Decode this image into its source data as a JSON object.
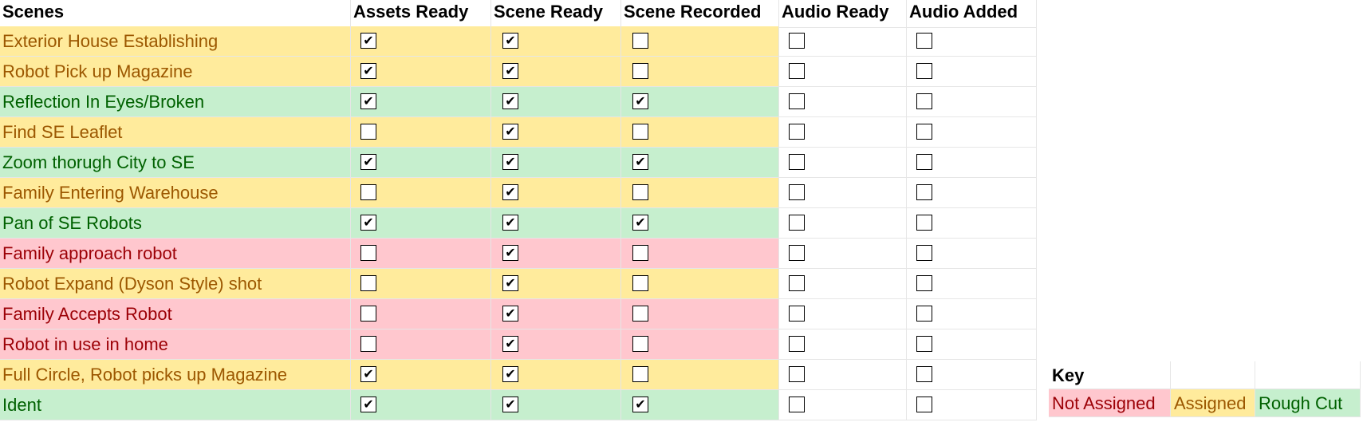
{
  "columns": {
    "scenes": "Scenes",
    "assets_ready": "Assets Ready",
    "scene_ready": "Scene Ready",
    "scene_recorded": "Scene Recorded",
    "audio_ready": "Audio Ready",
    "audio_added": "Audio Added"
  },
  "status_colors": {
    "not_assigned": {
      "bg": "#FFC7CE",
      "fg": "#9C0006"
    },
    "assigned": {
      "bg": "#FFEB9C",
      "fg": "#9C5700"
    },
    "rough_cut": {
      "bg": "#C6EFCE",
      "fg": "#006100"
    }
  },
  "rows": [
    {
      "scene": "Exterior House Establishing",
      "status": "assigned",
      "assets_ready": true,
      "scene_ready": true,
      "scene_recorded": false,
      "audio_ready": false,
      "audio_added": false
    },
    {
      "scene": "Robot Pick up Magazine",
      "status": "assigned",
      "assets_ready": true,
      "scene_ready": true,
      "scene_recorded": false,
      "audio_ready": false,
      "audio_added": false
    },
    {
      "scene": "Reflection In Eyes/Broken",
      "status": "rough_cut",
      "assets_ready": true,
      "scene_ready": true,
      "scene_recorded": true,
      "audio_ready": false,
      "audio_added": false
    },
    {
      "scene": "Find SE Leaflet",
      "status": "assigned",
      "assets_ready": false,
      "scene_ready": true,
      "scene_recorded": false,
      "audio_ready": false,
      "audio_added": false
    },
    {
      "scene": "Zoom thorugh City to SE",
      "status": "rough_cut",
      "assets_ready": true,
      "scene_ready": true,
      "scene_recorded": true,
      "audio_ready": false,
      "audio_added": false
    },
    {
      "scene": "Family Entering Warehouse",
      "status": "assigned",
      "assets_ready": false,
      "scene_ready": true,
      "scene_recorded": false,
      "audio_ready": false,
      "audio_added": false
    },
    {
      "scene": "Pan of SE Robots",
      "status": "rough_cut",
      "assets_ready": true,
      "scene_ready": true,
      "scene_recorded": true,
      "audio_ready": false,
      "audio_added": false
    },
    {
      "scene": "Family approach robot",
      "status": "not_assigned",
      "assets_ready": false,
      "scene_ready": true,
      "scene_recorded": false,
      "audio_ready": false,
      "audio_added": false
    },
    {
      "scene": "Robot Expand (Dyson Style) shot",
      "status": "assigned",
      "assets_ready": false,
      "scene_ready": true,
      "scene_recorded": false,
      "audio_ready": false,
      "audio_added": false
    },
    {
      "scene": "Family Accepts Robot",
      "status": "not_assigned",
      "assets_ready": false,
      "scene_ready": true,
      "scene_recorded": false,
      "audio_ready": false,
      "audio_added": false
    },
    {
      "scene": "Robot in use in home",
      "status": "not_assigned",
      "assets_ready": false,
      "scene_ready": true,
      "scene_recorded": false,
      "audio_ready": false,
      "audio_added": false
    },
    {
      "scene": "Full Circle, Robot picks up Magazine",
      "status": "assigned",
      "assets_ready": true,
      "scene_ready": true,
      "scene_recorded": false,
      "audio_ready": false,
      "audio_added": false
    },
    {
      "scene": "Ident",
      "status": "rough_cut",
      "assets_ready": true,
      "scene_ready": true,
      "scene_recorded": true,
      "audio_ready": false,
      "audio_added": false
    }
  ],
  "key": {
    "title": "Key",
    "not_assigned": "Not Assigned",
    "assigned": "Assigned",
    "rough_cut": "Rough Cut"
  }
}
